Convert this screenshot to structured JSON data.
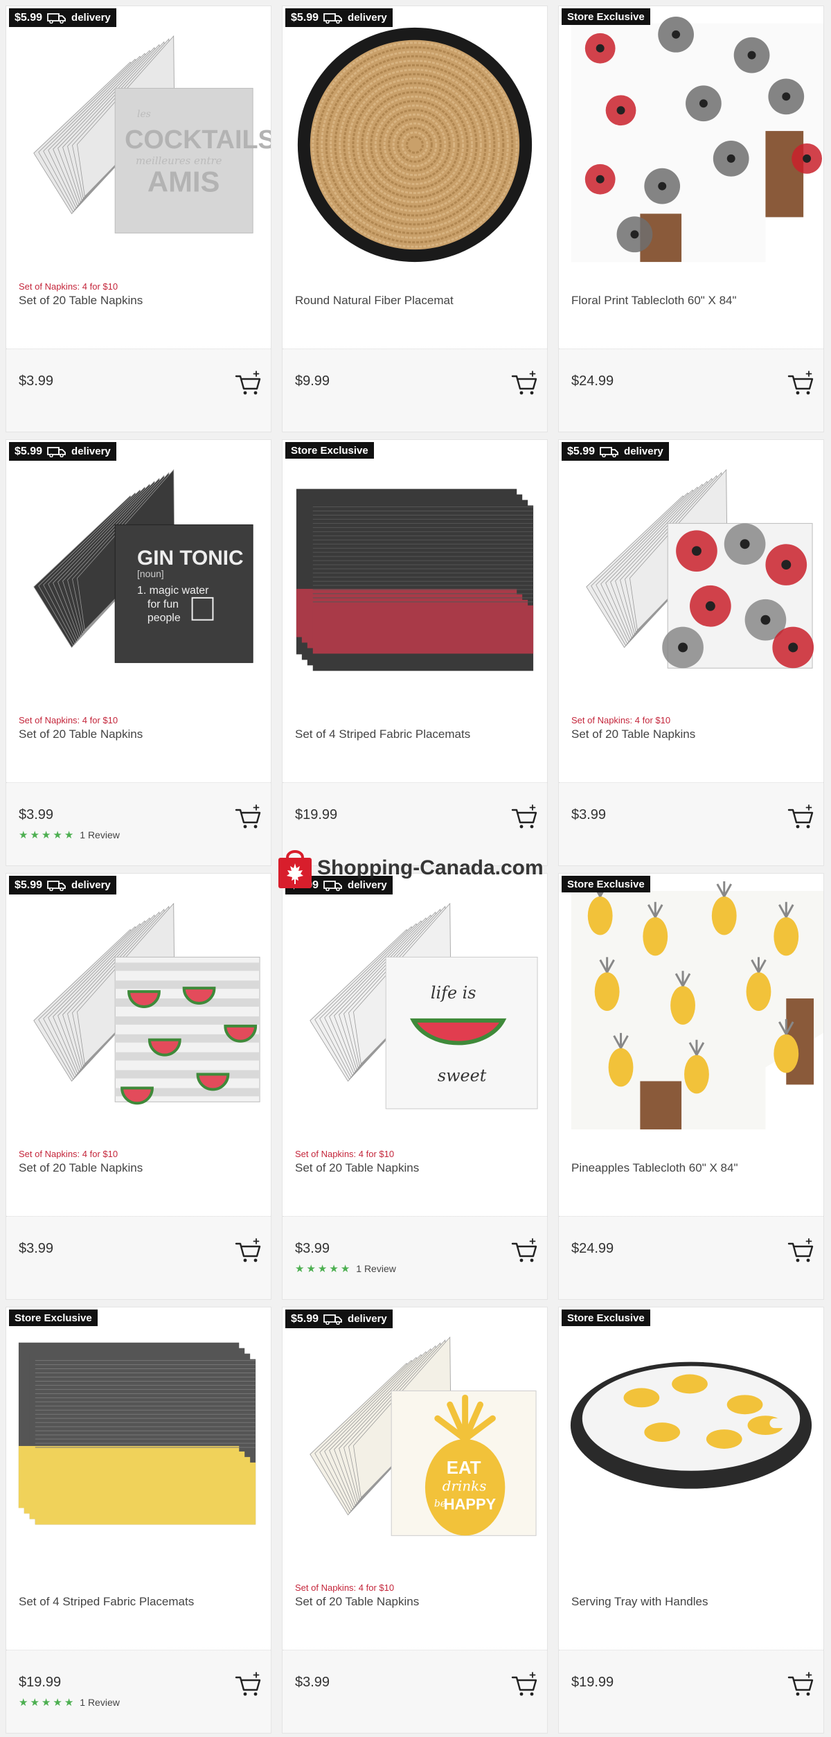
{
  "products": [
    {
      "badge": "$5.99",
      "badge_suffix": "delivery",
      "badge_type": "delivery",
      "promo": "Set of Napkins: 4 for $10",
      "title": "Set of 20 Table Napkins",
      "price": "$3.99",
      "rating": null,
      "reviews": "",
      "image": "cocktails-napkins",
      "image_text": [
        "les",
        "COCKTAILS",
        "meilleures entre",
        "AMIS"
      ]
    },
    {
      "badge": "$5.99",
      "badge_suffix": "delivery",
      "badge_type": "delivery",
      "promo": "",
      "title": "Round Natural Fiber Placemat",
      "price": "$9.99",
      "rating": null,
      "reviews": "",
      "image": "round-placemat",
      "image_text": []
    },
    {
      "badge": "Store Exclusive",
      "badge_suffix": "",
      "badge_type": "exclusive",
      "promo": "",
      "title": "Floral Print Tablecloth 60\" X 84\"",
      "price": "$24.99",
      "rating": null,
      "reviews": "",
      "image": "floral-tablecloth",
      "image_text": []
    },
    {
      "badge": "$5.99",
      "badge_suffix": "delivery",
      "badge_type": "delivery",
      "promo": "Set of Napkins: 4 for $10",
      "title": "Set of 20 Table Napkins",
      "price": "$3.99",
      "rating": 5,
      "reviews": "1 Review",
      "image": "gin-tonic-napkins",
      "image_text": [
        "GIN TONIC",
        "[noun]",
        "1. magic water",
        "for fun",
        "people"
      ]
    },
    {
      "badge": "Store Exclusive",
      "badge_suffix": "",
      "badge_type": "exclusive",
      "promo": "",
      "title": "Set of 4 Striped Fabric Placemats",
      "price": "$19.99",
      "rating": null,
      "reviews": "",
      "image": "red-placemats",
      "image_text": []
    },
    {
      "badge": "$5.99",
      "badge_suffix": "delivery",
      "badge_type": "delivery",
      "promo": "Set of Napkins: 4 for $10",
      "title": "Set of 20 Table Napkins",
      "price": "$3.99",
      "rating": null,
      "reviews": "",
      "image": "poppy-napkins",
      "image_text": []
    },
    {
      "badge": "$5.99",
      "badge_suffix": "delivery",
      "badge_type": "delivery",
      "promo": "Set of Napkins: 4 for $10",
      "title": "Set of 20 Table Napkins",
      "price": "$3.99",
      "rating": null,
      "reviews": "",
      "image": "watermelon-napkins",
      "image_text": []
    },
    {
      "badge": "$5.99",
      "badge_suffix": "delivery",
      "badge_type": "delivery",
      "promo": "Set of Napkins: 4 for $10",
      "title": "Set of 20 Table Napkins",
      "price": "$3.99",
      "rating": 5,
      "reviews": "1 Review",
      "image": "life-sweet-napkins",
      "image_text": [
        "life is",
        "sweet"
      ]
    },
    {
      "badge": "Store Exclusive",
      "badge_suffix": "",
      "badge_type": "exclusive",
      "promo": "",
      "title": "Pineapples Tablecloth 60\" X 84\"",
      "price": "$24.99",
      "rating": null,
      "reviews": "",
      "image": "pineapple-tablecloth",
      "image_text": []
    },
    {
      "badge": "Store Exclusive",
      "badge_suffix": "",
      "badge_type": "exclusive",
      "promo": "",
      "title": "Set of 4 Striped Fabric Placemats",
      "price": "$19.99",
      "rating": 5,
      "reviews": "1 Review",
      "image": "yellow-placemats",
      "image_text": []
    },
    {
      "badge": "$5.99",
      "badge_suffix": "delivery",
      "badge_type": "delivery",
      "promo": "Set of Napkins: 4 for $10",
      "title": "Set of 20 Table Napkins",
      "price": "$3.99",
      "rating": null,
      "reviews": "",
      "image": "pineapple-napkins",
      "image_text": [
        "EAT",
        "drinks",
        "be",
        "HAPPY"
      ]
    },
    {
      "badge": "Store Exclusive",
      "badge_suffix": "",
      "badge_type": "exclusive",
      "promo": "",
      "title": "Serving Tray with Handles",
      "price": "$19.99",
      "rating": null,
      "reviews": "",
      "image": "serving-tray",
      "image_text": []
    }
  ],
  "watermark": {
    "text": "Shopping-Canada.com",
    "icon": "shopping-bag-maple-leaf-icon"
  },
  "colors": {
    "promo": "#c4263b",
    "star": "#4caf50",
    "badge_bg": "#111111",
    "footer_bg": "#f7f7f7"
  }
}
